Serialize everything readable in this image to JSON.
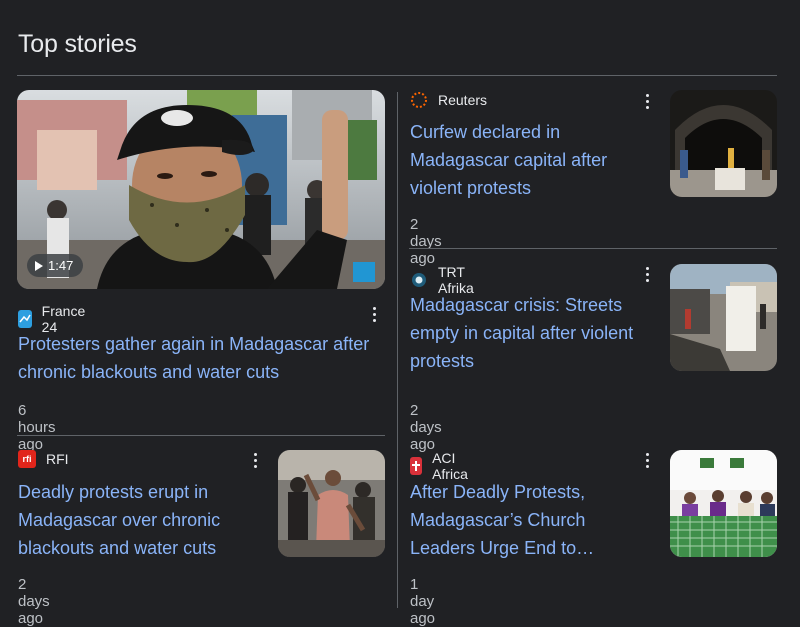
{
  "section_title": "Top stories",
  "stories": {
    "main": {
      "source": "France 24",
      "headline": "Protesters gather again in Madagascar after chronic blackouts and water cuts",
      "time": "6 hours ago",
      "duration": "1:47"
    },
    "reuters": {
      "source": "Reuters",
      "headline": "Curfew declared in Madagascar capital after violent protests",
      "time": "2 days ago"
    },
    "trt": {
      "source": "TRT Afrika",
      "headline": "Madagascar crisis: Streets empty in capital after violent protests",
      "time": "2 days ago"
    },
    "rfi": {
      "source": "RFI",
      "source_icon_text": "rfi",
      "headline": "Deadly protests erupt in Madagascar over chronic blackouts and water cuts",
      "time": "2 days ago"
    },
    "aci": {
      "source": "ACI Africa",
      "headline": "After Deadly Protests, Madagascar’s Church Leaders Urge End to…",
      "time": "1 day ago"
    }
  },
  "colors": {
    "background": "#202124",
    "headline": "#8ab4f8",
    "text": "#e8eaed",
    "muted": "#bdc1c6",
    "divider": "#5f6368"
  }
}
